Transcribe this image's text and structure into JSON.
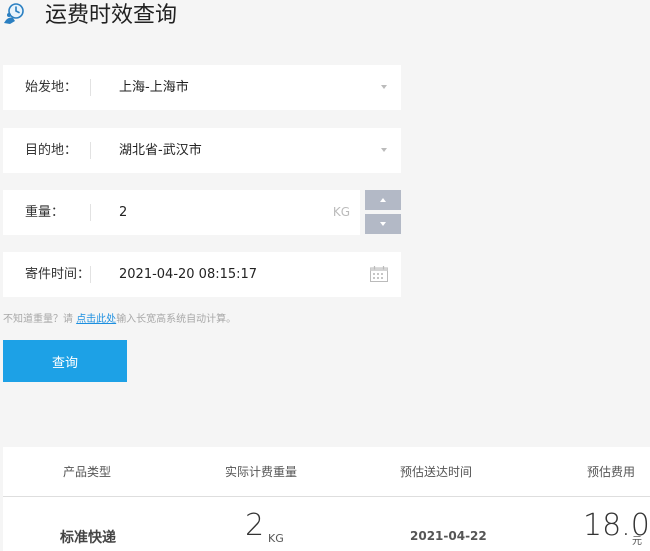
{
  "header": {
    "title": "运费时效查询",
    "logo_icon": "delivery-courier-icon"
  },
  "form": {
    "origin": {
      "label": "始发地：",
      "value": "上海-上海市"
    },
    "destination": {
      "label": "目的地：",
      "value": "湖北省-武汉市"
    },
    "weight": {
      "label": "重量：",
      "value": "2",
      "unit": "KG"
    },
    "send_time": {
      "label": "寄件时间：",
      "value": "2021-04-20 08:15:17"
    }
  },
  "hint": {
    "prefix": "不知道重量？请 ",
    "link": "点击此处",
    "suffix": "输入长宽高系统自动计算。"
  },
  "query_button": {
    "label": "查询"
  },
  "results": {
    "columns": [
      "产品类型",
      "实际计费重量",
      "预估送达时间",
      "预估费用"
    ],
    "row": {
      "product": "标准快递",
      "weight": "2",
      "weight_unit": "KG",
      "arrival": "2021-04-22",
      "fee": "18.0",
      "fee_unit": "元"
    }
  },
  "colors": {
    "accent": "#1da1e6",
    "link": "#1c8fe0",
    "stepper": "#b3b9c6",
    "background": "#f5f5f5"
  }
}
